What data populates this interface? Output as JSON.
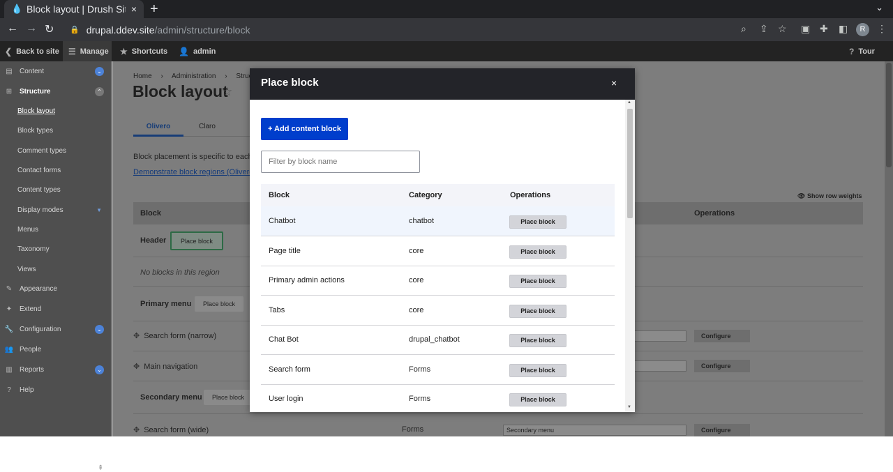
{
  "browser": {
    "tab_title": "Block layout | Drush Site-I",
    "tab_close": "×",
    "new_tab": "+",
    "tab_menu": "⌄",
    "url_host": "drupal.ddev.site",
    "url_path": "/admin/structure/block",
    "avatar_letter": "R"
  },
  "admin_toolbar": {
    "back": "Back to site",
    "manage": "Manage",
    "shortcuts": "Shortcuts",
    "user": "admin",
    "tour": "Tour"
  },
  "sidebar": {
    "items": [
      {
        "label": "Content"
      },
      {
        "label": "Structure"
      },
      {
        "label": "Block layout"
      },
      {
        "label": "Block types"
      },
      {
        "label": "Comment types"
      },
      {
        "label": "Contact forms"
      },
      {
        "label": "Content types"
      },
      {
        "label": "Display modes"
      },
      {
        "label": "Menus"
      },
      {
        "label": "Taxonomy"
      },
      {
        "label": "Views"
      },
      {
        "label": "Appearance"
      },
      {
        "label": "Extend"
      },
      {
        "label": "Configuration"
      },
      {
        "label": "People"
      },
      {
        "label": "Reports"
      },
      {
        "label": "Help"
      }
    ]
  },
  "page": {
    "breadcrumb": [
      "Home",
      "Administration",
      "Structur"
    ],
    "title": "Block layout",
    "tabs": [
      "Olivero",
      "Claro"
    ],
    "description": "Block placement is specific to each",
    "demo_link": "Demonstrate block regions (Olivero",
    "show_row_weights": "Show row weights",
    "table_headers": {
      "block": "Block",
      "operations": "Operations"
    },
    "regions": {
      "header": "Header",
      "primary_menu": "Primary menu",
      "secondary_menu": "Secondary menu"
    },
    "place_block": "Place block",
    "no_blocks": "No blocks in this region",
    "blocks": [
      {
        "name": "Search form (narrow)",
        "select": "",
        "configure": "Configure"
      },
      {
        "name": "Main navigation",
        "select": "",
        "configure": "Configure"
      },
      {
        "name": "Search form (wide)",
        "category": "Forms",
        "select": "Secondary menu",
        "configure": "Configure"
      }
    ]
  },
  "modal": {
    "title": "Place block",
    "close": "×",
    "add_button": "+ Add content block",
    "filter_placeholder": "Filter by block name",
    "headers": {
      "block": "Block",
      "category": "Category",
      "operations": "Operations"
    },
    "button_label": "Place block",
    "rows": [
      {
        "block": "Chatbot",
        "category": "chatbot"
      },
      {
        "block": "Page title",
        "category": "core"
      },
      {
        "block": "Primary admin actions",
        "category": "core"
      },
      {
        "block": "Tabs",
        "category": "core"
      },
      {
        "block": "Chat Bot",
        "category": "drupal_chatbot"
      },
      {
        "block": "Search form",
        "category": "Forms"
      },
      {
        "block": "User login",
        "category": "Forms"
      }
    ]
  },
  "colors": {
    "primary_button": "#003ecc",
    "modal_header": "#232429",
    "sidebar_bg": "#4f4f4f",
    "toolbar_bg": "#232323",
    "badge": "#4c82d8"
  }
}
